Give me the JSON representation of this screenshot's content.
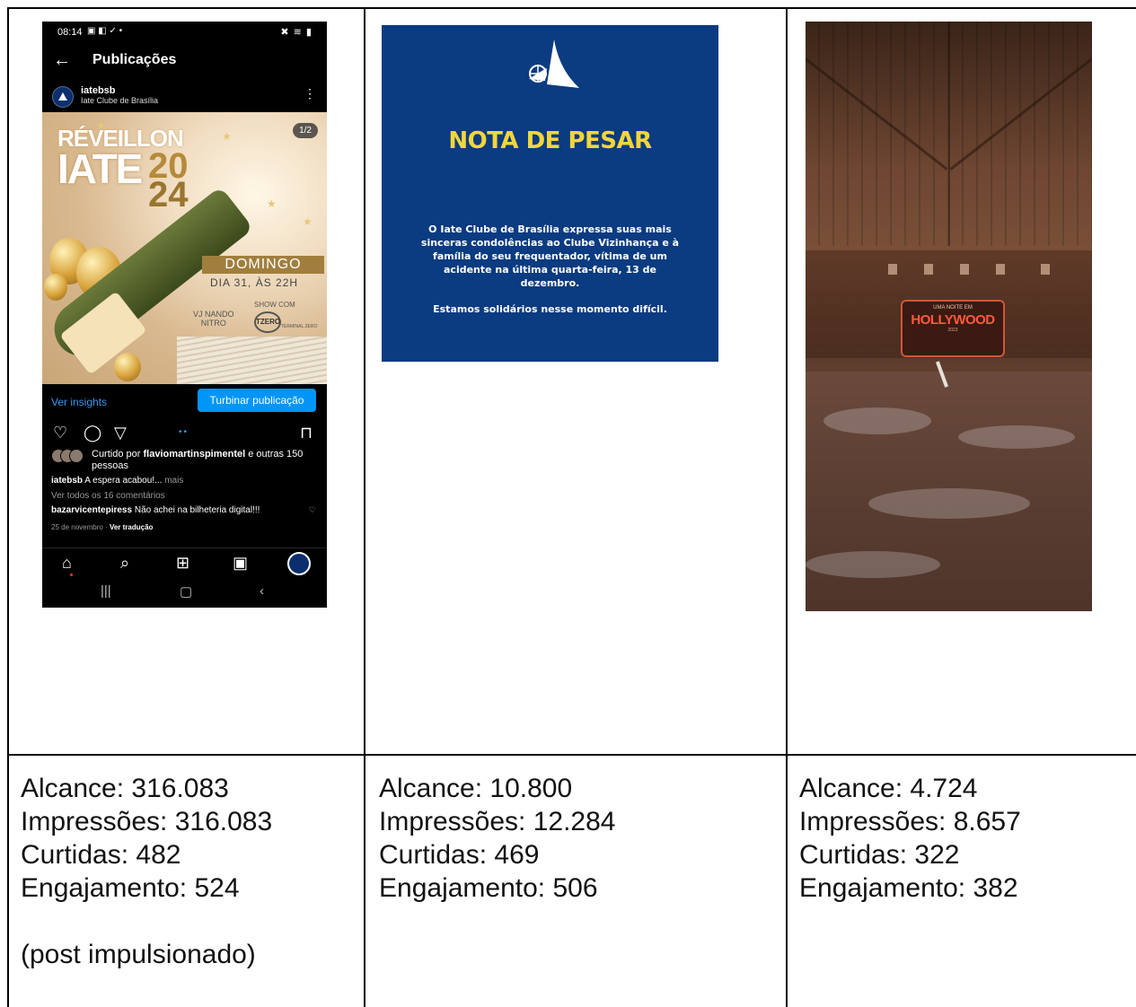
{
  "post1": {
    "phone": {
      "status_time": "08:14",
      "status_icons_left": "▣ ◧ ✓ •",
      "status_icons_right": "✖ ≋ ▮",
      "screen_title": "Publicações",
      "username": "iatebsb",
      "user_subtitle": "Iate Clube de Brasília",
      "poster": {
        "line1": "RÉVEILLON",
        "line2": "IATE",
        "year_top": "20",
        "year_bottom": "24",
        "counter": "1/2",
        "day": "DOMINGO",
        "date_time": "DIA 31, ÀS 22H",
        "vj": "VJ NANDO\nNITRO",
        "show": "SHOW COM",
        "tz_logo": "TZERO",
        "tz_sub": "TERMINAL ZERO"
      },
      "insights_label": "Ver insights",
      "boost_label": "Turbinar publicação",
      "liked_prefix": "Curtido por ",
      "liked_user": "flaviomartinspimentel",
      "liked_suffix": " e outras 150 pessoas",
      "caption_user": "iatebsb",
      "caption_text": " A espera acabou!...",
      "caption_more": " mais",
      "view_all_comments": "Ver todos os 16 comentários",
      "comment_user": "bazarvicentepiress",
      "comment_text": " Não achei na bilheteria digital!!!",
      "post_date": "25 de novembro",
      "see_translation": "Ver tradução"
    },
    "stats": {
      "alcance": "Alcance: 316.083",
      "impressoes": "Impressões: 316.083",
      "curtidas": "Curtidas: 482",
      "engajamento": "Engajamento: 524",
      "note": "(post impulsionado)"
    }
  },
  "post2": {
    "title": "NOTA DE PESAR",
    "body": "O Iate Clube de Brasília expressa suas mais sinceras condolências ao Clube Vizinhança e à família do seu frequentador, vítima de um acidente na última quarta-feira, 13 de dezembro.",
    "closing": "Estamos solidários nesse momento difícil.",
    "stats": {
      "alcance": "Alcance: 10.800",
      "impressoes": "Impressões: 12.284",
      "curtidas": "Curtidas: 469",
      "engajamento": "Engajamento: 506"
    }
  },
  "post3": {
    "sign_top": "UMA NOITE EM",
    "sign_main": "HOLLYWOOD",
    "sign_bottom": "2023",
    "stats": {
      "alcance": "Alcance: 4.724",
      "impressoes": "Impressões: 8.657",
      "curtidas": "Curtidas: 322",
      "engajamento": "Engajamento: 382"
    }
  },
  "colors": {
    "nota_bg": "#0b3b80",
    "nota_title": "#f2d63a",
    "instagram_blue": "#0095f6"
  }
}
